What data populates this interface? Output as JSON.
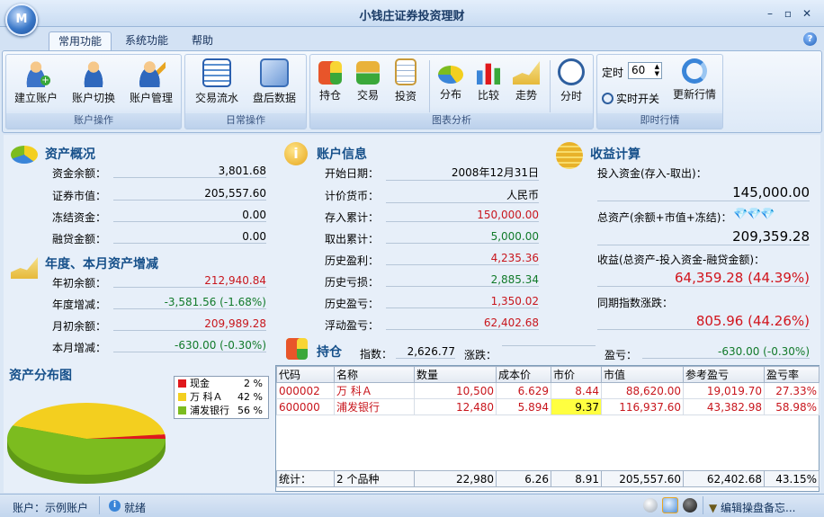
{
  "app": {
    "title": "小钱庄证券投资理财",
    "orb_label": "M"
  },
  "window_controls": {
    "minimize": "–",
    "restore": "▫",
    "close": "✕"
  },
  "tabs": [
    {
      "label": "常用功能"
    },
    {
      "label": "系统功能"
    },
    {
      "label": "帮助"
    }
  ],
  "help_label": "?",
  "ribbon": {
    "account_ops": {
      "caption": "账户操作",
      "buttons": [
        "建立账户",
        "账户切换",
        "账户管理"
      ]
    },
    "daily_ops": {
      "caption": "日常操作",
      "buttons": [
        "交易流水",
        "盘后数据"
      ]
    },
    "chart_analysis": {
      "caption": "图表分析",
      "buttons": [
        "持仓",
        "交易",
        "投资",
        "分布",
        "比较",
        "走势",
        "分时"
      ]
    },
    "realtime": {
      "caption": "即时行情",
      "timer_label": "定时",
      "timer_value": "60",
      "realtime_toggle": "实时开关",
      "update_button": "更新行情"
    }
  },
  "asset_overview": {
    "title": "资产概况",
    "rows": [
      {
        "label": "资金余额：",
        "value": "3,801.68"
      },
      {
        "label": "证券市值：",
        "value": "205,557.60"
      },
      {
        "label": "冻结资金：",
        "value": "0.00"
      },
      {
        "label": "融贷金额：",
        "value": "0.00"
      }
    ]
  },
  "annual_change": {
    "title": "年度、本月资产增减",
    "rows": [
      {
        "label": "年初余额：",
        "value": "212,940.84"
      },
      {
        "label": "年度增减：",
        "value": "-3,581.56 (-1.68%)"
      },
      {
        "label": "月初余额：",
        "value": "209,989.28"
      },
      {
        "label": "本月增减：",
        "value": "-630.00 (-0.30%)"
      }
    ]
  },
  "account_info": {
    "title": "账户信息",
    "rows": [
      {
        "label": "开始日期：",
        "value": "2008年12月31日"
      },
      {
        "label": "计价货币：",
        "value": "人民币"
      },
      {
        "label": "存入累计：",
        "value": "150,000.00"
      },
      {
        "label": "取出累计：",
        "value": "5,000.00"
      },
      {
        "label": "历史盈利：",
        "value": "4,235.36"
      },
      {
        "label": "历史亏损：",
        "value": "2,885.34"
      },
      {
        "label": "历史盈亏：",
        "value": "1,350.02"
      },
      {
        "label": "浮动盈亏：",
        "value": "62,402.68"
      }
    ]
  },
  "income": {
    "title": "收益计算",
    "invested_label": "投入资金(存入-取出)：",
    "invested_value": "145,000.00",
    "total_label": "总资产(余额+市值+冻结)：",
    "total_value": "209,359.28",
    "profit_label": "收益(总资产-投入资金-融贷金额)：",
    "profit_value": "64,359.28 (44.39%)",
    "index_label": "同期指数涨跌：",
    "index_value": "805.96 (44.26%)"
  },
  "holdings": {
    "title": "持仓",
    "index_label": "指数：",
    "index_value": "2,626.77",
    "change_label": "涨跌：",
    "change_value": "",
    "pl_label": "盈亏：",
    "pl_value": "-630.00 (-0.30%)",
    "columns": [
      "代码",
      "名称",
      "数量",
      "成本价",
      "市价",
      "市值",
      "参考盈亏",
      "盈亏率"
    ],
    "rows": [
      [
        "000002",
        "万 科Ａ",
        "10,500",
        "6.629",
        "8.44",
        "88,620.00",
        "19,019.70",
        "27.33%"
      ],
      [
        "600000",
        "浦发银行",
        "12,480",
        "5.894",
        "9.37",
        "116,937.60",
        "43,382.98",
        "58.98%"
      ]
    ],
    "summary": [
      "统计：",
      "2 个品种",
      "22,980",
      "6.26",
      "8.91",
      "205,557.60",
      "62,402.68",
      "43.15%"
    ]
  },
  "distribution": {
    "title": "资产分布图",
    "legend": [
      {
        "name": "现金",
        "pct": "2 %",
        "color": "#e0181c"
      },
      {
        "name": "万 科Ａ",
        "pct": "42 %",
        "color": "#f3cf1f"
      },
      {
        "name": "浦发银行",
        "pct": "56 %",
        "color": "#7cbc1f"
      }
    ]
  },
  "chart_data": {
    "type": "pie",
    "title": "资产分布图",
    "categories": [
      "现金",
      "万 科Ａ",
      "浦发银行"
    ],
    "values": [
      2,
      42,
      56
    ],
    "colors": [
      "#e0181c",
      "#f3cf1f",
      "#7cbc1f"
    ]
  },
  "status": {
    "account": "账户：示例账户",
    "state": "就绪",
    "memo": "编辑操盘备忘..."
  }
}
